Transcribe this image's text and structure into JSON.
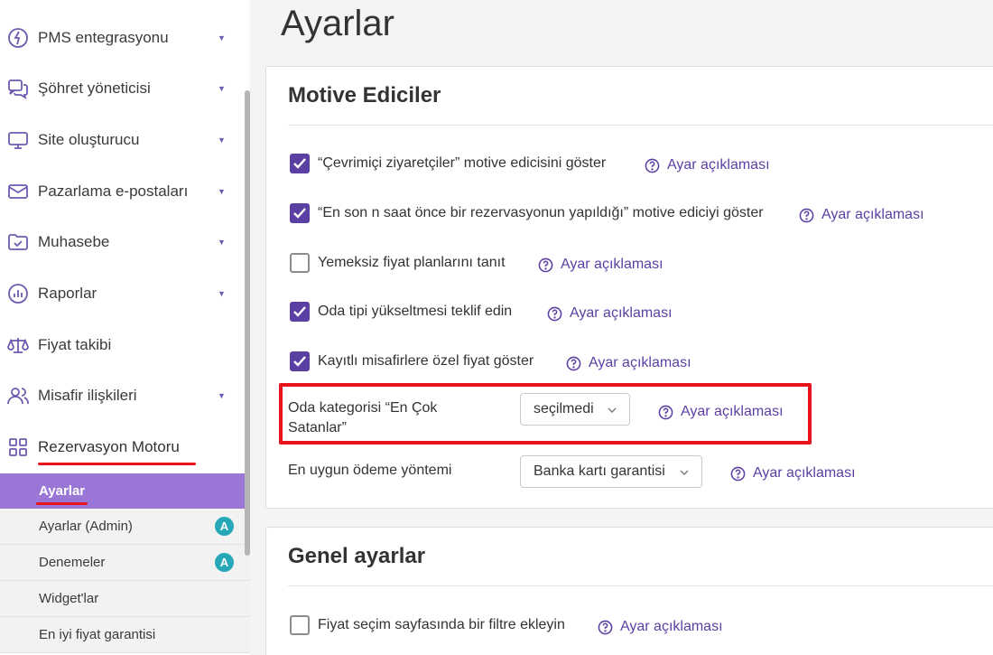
{
  "sidebar": {
    "items": [
      {
        "label": "PMS entegrasyonu",
        "icon": "pms-icon",
        "chevron": "▼"
      },
      {
        "label": "Şöhret yöneticisi",
        "icon": "chat-bubbles-icon",
        "chevron": "▼"
      },
      {
        "label": "Site oluşturucu",
        "icon": "monitor-icon",
        "chevron": "▼"
      },
      {
        "label": "Pazarlama e-postaları",
        "icon": "envelope-icon",
        "chevron": "▼"
      },
      {
        "label": "Muhasebe",
        "icon": "folder-check-icon",
        "chevron": "▼"
      },
      {
        "label": "Raporlar",
        "icon": "chart-circle-icon",
        "chevron": "▼"
      },
      {
        "label": "Fiyat takibi",
        "icon": "scales-icon",
        "chevron": ""
      },
      {
        "label": "Misafir ilişkileri",
        "icon": "users-icon",
        "chevron": "▼"
      },
      {
        "label": "Rezervasyon Motoru",
        "icon": "grid-icon",
        "chevron": ""
      }
    ],
    "submenu": [
      {
        "label": "Ayarlar",
        "active": true,
        "badge": ""
      },
      {
        "label": "Ayarlar (Admin)",
        "active": false,
        "badge": "A"
      },
      {
        "label": "Denemeler",
        "active": false,
        "badge": "A"
      },
      {
        "label": "Widget'lar",
        "active": false,
        "badge": ""
      },
      {
        "label": "En iyi fiyat garantisi",
        "active": false,
        "badge": ""
      }
    ]
  },
  "main": {
    "title": "Ayarlar",
    "motive": {
      "title": "Motive Ediciler",
      "options": [
        {
          "label": "“Çevrimiçi ziyaretçiler” motive edicisini göster",
          "checked": true,
          "help": "Ayar açıklaması"
        },
        {
          "label": "“En son n saat önce bir rezervasyonun yapıldığı” motive ediciyi göster",
          "checked": true,
          "help": "Ayar açıklaması"
        },
        {
          "label": "Yemeksiz fiyat planlarını tanıt",
          "checked": false,
          "help": "Ayar açıklaması"
        },
        {
          "label": "Oda tipi yükseltmesi teklif edin",
          "checked": true,
          "help": "Ayar açıklaması"
        },
        {
          "label": "Kayıtlı misafirlere özel fiyat göster",
          "checked": true,
          "help": "Ayar açıklaması"
        }
      ],
      "bestsellers": {
        "label_line1": "Oda kategorisi “En Çok",
        "label_line2": "Satanlar”",
        "value": "seçilmedi",
        "help": "Ayar açıklaması"
      },
      "payment": {
        "label": "En uygun ödeme yöntemi",
        "value": "Banka kartı garantisi",
        "help": "Ayar açıklaması"
      }
    },
    "general": {
      "title": "Genel ayarlar",
      "options": [
        {
          "label": "Fiyat seçim sayfasında bir filtre ekleyin",
          "checked": false,
          "help": "Ayar açıklaması"
        }
      ]
    }
  },
  "colors": {
    "accent": "#5b3fa3",
    "active_menu": "#9a76d6",
    "highlight": "#e8141b",
    "badge": "#27a8b8"
  }
}
